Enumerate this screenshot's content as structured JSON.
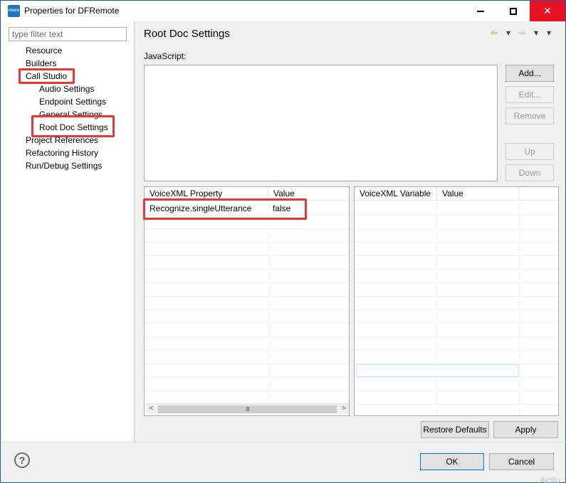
{
  "window": {
    "title": "Properties for DFRemote",
    "app_icon_text": "cisco",
    "minimize_symbol": "",
    "maximize_symbol": "",
    "close_symbol": "✕"
  },
  "sidebar": {
    "filter_placeholder": "type filter text",
    "items": [
      {
        "label": "Resource",
        "level": 0,
        "highlighted": false
      },
      {
        "label": "Builders",
        "level": 0,
        "highlighted": false
      },
      {
        "label": "Call Studio",
        "level": 0,
        "highlighted": true
      },
      {
        "label": "Audio Settings",
        "level": 1,
        "highlighted": false
      },
      {
        "label": "Endpoint Settings",
        "level": 1,
        "highlighted": false
      },
      {
        "label": "General Settings",
        "level": 1,
        "highlighted": false
      },
      {
        "label": "Root Doc Settings",
        "level": 1,
        "highlighted": true,
        "selected": true
      },
      {
        "label": "Project References",
        "level": 0,
        "highlighted": false
      },
      {
        "label": "Refactoring History",
        "level": 0,
        "highlighted": false
      },
      {
        "label": "Run/Debug Settings",
        "level": 0,
        "highlighted": false
      }
    ]
  },
  "main": {
    "title": "Root Doc Settings",
    "nav": {
      "back_icon": "⇦",
      "back_menu_icon": "▾",
      "forward_icon": "⇨",
      "forward_menu_icon": "▾",
      "view_menu_icon": "▾"
    },
    "javascript_label": "JavaScript:",
    "javascript_value": "",
    "buttons": {
      "add": "Add...",
      "edit": "Edit...",
      "remove": "Remove",
      "up": "Up",
      "down": "Down"
    },
    "property_table": {
      "columns": [
        "VoiceXML Property",
        "Value"
      ],
      "rows": [
        {
          "property": "Recognize.singleUtterance",
          "value": "false",
          "highlighted": true
        }
      ],
      "scroll_left": "<",
      "scroll_right": ">",
      "scroll_grip": "III"
    },
    "variable_table": {
      "columns": [
        "VoiceXML Variable",
        "Value"
      ],
      "rows": []
    },
    "restore_defaults": "Restore Defaults",
    "apply": "Apply"
  },
  "footer": {
    "help_icon": "?",
    "ok": "OK",
    "cancel": "Cancel",
    "watermark": "Activ"
  },
  "colors": {
    "highlight_border": "#e53935",
    "close_button": "#e81123",
    "ok_border": "#0078d7"
  }
}
